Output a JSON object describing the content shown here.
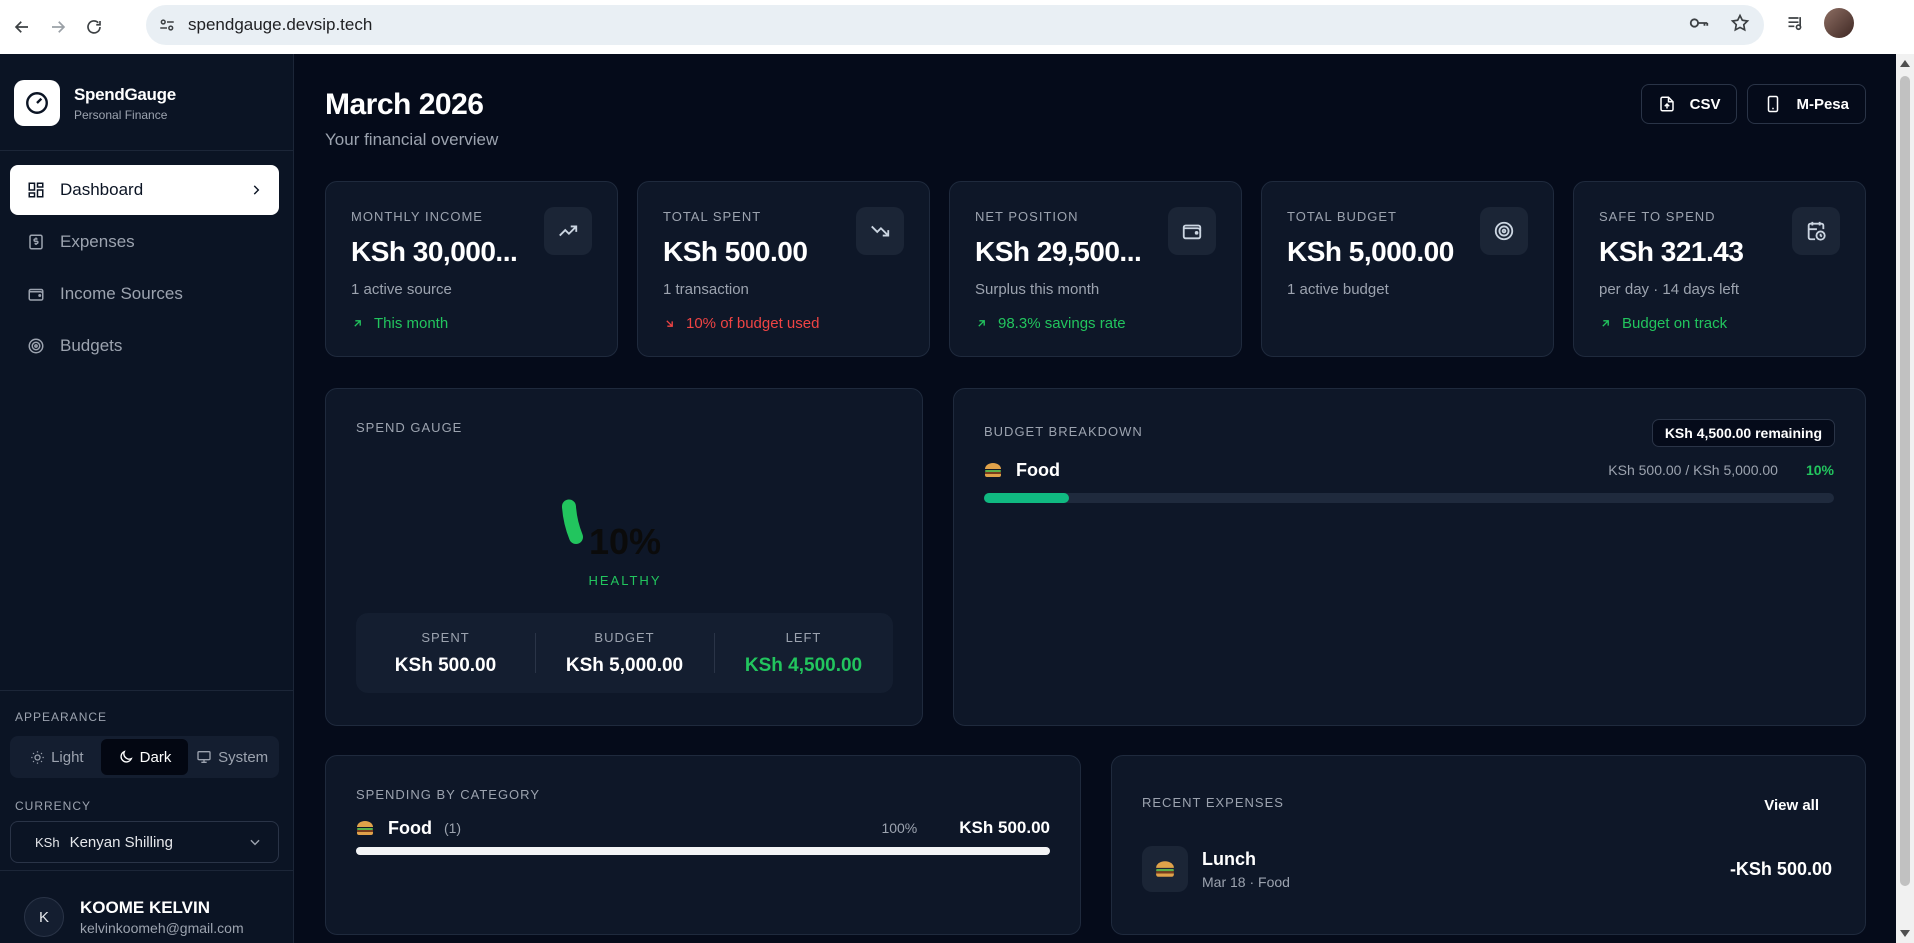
{
  "browser": {
    "url": "spendgauge.devsip.tech"
  },
  "sidebar": {
    "brand_name": "SpendGauge",
    "brand_sub": "Personal Finance",
    "nav": [
      {
        "label": "Dashboard",
        "icon": "layout-grid-icon",
        "active": true
      },
      {
        "label": "Expenses",
        "icon": "receipt-icon",
        "active": false
      },
      {
        "label": "Income Sources",
        "icon": "wallet-icon",
        "active": false
      },
      {
        "label": "Budgets",
        "icon": "target-icon",
        "active": false
      }
    ],
    "appearance_label": "APPEARANCE",
    "theme": {
      "options": [
        "Light",
        "Dark",
        "System"
      ],
      "selected": "Dark"
    },
    "currency_label": "CURRENCY",
    "currency": {
      "symbol": "KSh",
      "name": "Kenyan Shilling"
    },
    "user": {
      "initial": "K",
      "name": "KOOME KELVIN",
      "email": "kelvinkoomeh@gmail.com"
    }
  },
  "header": {
    "title": "March 2026",
    "subtitle": "Your financial overview",
    "csv_label": "CSV",
    "mpesa_label": "M-Pesa"
  },
  "stats": [
    {
      "label": "MONTHLY INCOME",
      "value": "KSh 30,000...",
      "desc": "1 active source",
      "trend": "This month",
      "trend_color": "green",
      "icon": "trending-up-icon"
    },
    {
      "label": "TOTAL SPENT",
      "value": "KSh 500.00",
      "desc": "1 transaction",
      "trend": "10% of budget used",
      "trend_color": "red",
      "icon": "trending-down-icon"
    },
    {
      "label": "NET POSITION",
      "value": "KSh 29,500...",
      "desc": "Surplus this month",
      "trend": "98.3% savings rate",
      "trend_color": "green",
      "icon": "wallet-icon"
    },
    {
      "label": "TOTAL BUDGET",
      "value": "KSh 5,000.00",
      "desc": "1 active budget",
      "trend": "",
      "trend_color": "green",
      "icon": "target-icon"
    },
    {
      "label": "SAFE TO SPEND",
      "value": "KSh 321.43",
      "desc": "per day · 14 days left",
      "trend": "Budget on track",
      "trend_color": "green",
      "icon": "calendar-clock-icon"
    }
  ],
  "gauge": {
    "label": "SPEND GAUGE",
    "percent_text": "10%",
    "percent": 10,
    "status": "HEALTHY",
    "spent_label": "SPENT",
    "spent": "KSh 500.00",
    "budget_label": "BUDGET",
    "budget": "KSh 5,000.00",
    "left_label": "LEFT",
    "left": "KSh 4,500.00",
    "colors": {
      "fill": "#22c55e"
    }
  },
  "budget_breakdown": {
    "label": "BUDGET BREAKDOWN",
    "remaining": "KSh 4,500.00 remaining",
    "items": [
      {
        "name": "Food",
        "amount": "KSh 500.00 / KSh 5,000.00",
        "percent_text": "10%",
        "percent": 10
      }
    ]
  },
  "spending_by_category": {
    "label": "SPENDING BY CATEGORY",
    "items": [
      {
        "name": "Food",
        "count": "(1)",
        "percent_text": "100%",
        "percent": 100,
        "amount": "KSh 500.00"
      }
    ]
  },
  "recent_expenses": {
    "label": "RECENT EXPENSES",
    "view_all": "View all",
    "items": [
      {
        "name": "Lunch",
        "meta": "Mar 18 · Food",
        "amount": "-KSh 500.00"
      }
    ]
  }
}
